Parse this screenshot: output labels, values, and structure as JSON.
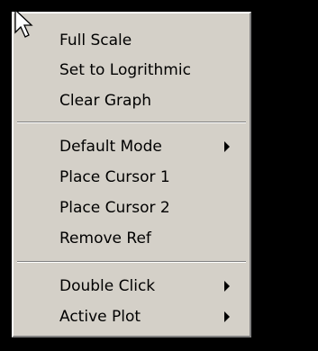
{
  "context_menu": {
    "items": [
      {
        "label": "Full Scale"
      },
      {
        "label": "Set to Logrithmic"
      },
      {
        "label": "Clear Graph"
      },
      {
        "label": "Default Mode",
        "has_submenu": true
      },
      {
        "label": "Place Cursor 1"
      },
      {
        "label": "Place Cursor 2"
      },
      {
        "label": "Remove Ref"
      },
      {
        "label": "Double Click",
        "has_submenu": true
      },
      {
        "label": "Active Plot",
        "has_submenu": true
      }
    ]
  },
  "colors": {
    "menu_background": "#d4d0c8",
    "screen_background": "#000000",
    "text": "#000000"
  },
  "icons": {
    "pointer": "arrow-cursor-icon",
    "submenu": "submenu-arrow-icon"
  }
}
